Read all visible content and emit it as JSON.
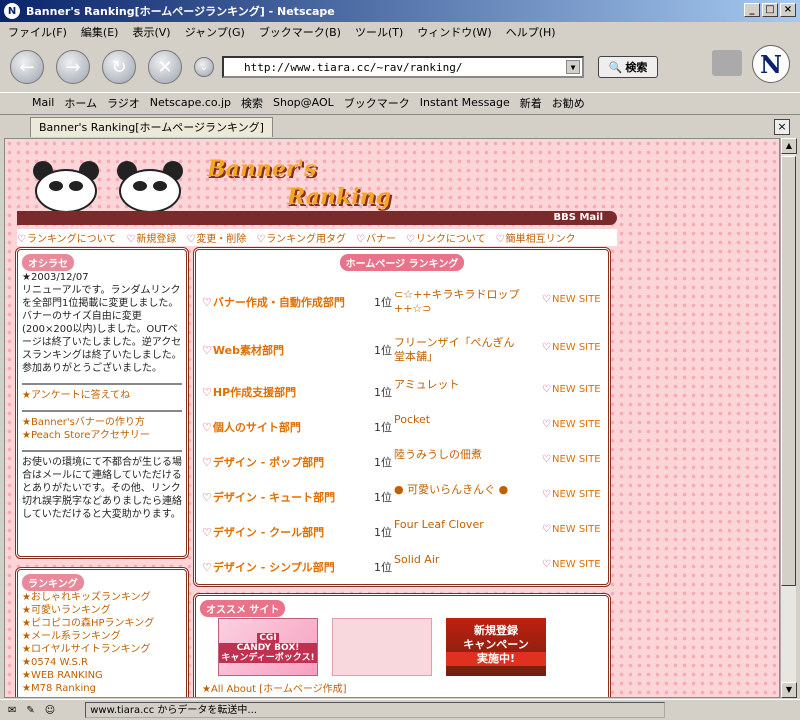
{
  "window": {
    "title": "Banner's Ranking[ホームページランキング] - Netscape"
  },
  "menu": [
    "ファイル(F)",
    "編集(E)",
    "表示(V)",
    "ジャンプ(G)",
    "ブックマーク(B)",
    "ツール(T)",
    "ウィンドウ(W)",
    "ヘルプ(H)"
  ],
  "navbar": {
    "url": "http://www.tiara.cc/~rav/ranking/",
    "search_label": "検索"
  },
  "personal": [
    "Mail",
    "ホーム",
    "ラジオ",
    "Netscape.co.jp",
    "検索",
    "Shop@AOL",
    "ブックマーク",
    "Instant Message",
    "新着",
    "お勧め"
  ],
  "tab": {
    "label": "Banner's Ranking[ホームページランキング]"
  },
  "page": {
    "logo_line1": "Banner's",
    "logo_line2": "Ranking",
    "header_links": "BBS   Mail",
    "topnav": [
      "ランキングについて",
      "新規登録",
      "変更・削除",
      "ランキング用タグ",
      "バナー",
      "リンクについて",
      "簡単相互リンク"
    ],
    "oshirase": {
      "title": "オシラセ",
      "date": "★2003/12/07",
      "body": "リニューアルです。ランダムリンクを全部門1位掲載に変更しました。バナーのサイズ自由に変更(200×200以内)しました。OUTページは終了いたしました。逆アクセスランキングは終了いたしました。参加ありがとうございました。",
      "survey": "★アンケートに答えてね",
      "banner_howto": "★Banner'sバナーの作り方",
      "peach": "★Peach Storeアクセサリー",
      "contact": "お使いの環境にて不都合が生じる場合はメールにて連絡していただけるとありがたいです。その他、リンク切れ誤字脱字などありましたら連絡していただけると大変助かります。"
    },
    "ranking_side": {
      "title": "ランキング",
      "items": [
        "★おしゃれキッズランキング",
        "★可愛いランキング",
        "★ピコピコの森HPランキング",
        "★メール系ランキング",
        "★ロイヤルサイトランキング",
        "★0574 W.S.R",
        "★WEB RANKING",
        "★M78 Ranking"
      ]
    },
    "hp_ranking": {
      "title": "ホームページ ランキング",
      "rows": [
        {
          "cat": "バナー作成・自動作成部門",
          "pos": "1位",
          "site": "⊂☆++キラキラドロップ++☆⊃",
          "new": "NEW SITE"
        },
        {
          "cat": "Web素材部門",
          "pos": "1位",
          "site": "フリーンザイ「ぺんぎん堂本舗」",
          "new": "NEW SITE"
        },
        {
          "cat": "HP作成支援部門",
          "pos": "1位",
          "site": "アミュレット",
          "new": "NEW SITE"
        },
        {
          "cat": "個人のサイト部門",
          "pos": "1位",
          "site": "Pocket",
          "new": "NEW SITE"
        },
        {
          "cat": "デザイン - ポップ部門",
          "pos": "1位",
          "site": "陸うみうしの佃煮",
          "new": "NEW SITE"
        },
        {
          "cat": "デザイン - キュート部門",
          "pos": "1位",
          "site": "● 可愛いらんきんぐ ●",
          "new": "NEW SITE"
        },
        {
          "cat": "デザイン - クール部門",
          "pos": "1位",
          "site": "Four Leaf Clover",
          "new": "NEW SITE"
        },
        {
          "cat": "デザイン - シンプル部門",
          "pos": "1位",
          "site": "Solid  Air",
          "new": "NEW SITE"
        }
      ]
    },
    "osusume": {
      "title": "オススメ サイト",
      "banner1": {
        "line1": "CGI",
        "line2": "CANDY BOX!",
        "line3": "キャンディーボックス!"
      },
      "banner3": {
        "line1": "新規登録",
        "line2": "キャンペーン",
        "line3": "実施中!"
      },
      "link": "★All About [ホームページ作成]"
    }
  },
  "status": {
    "text": "www.tiara.cc からデータを転送中..."
  },
  "colors": {
    "accent": "#e07000",
    "heart": "#d0335c",
    "frame": "#8a2c1a",
    "bg_pink": "#fcd5d9"
  }
}
